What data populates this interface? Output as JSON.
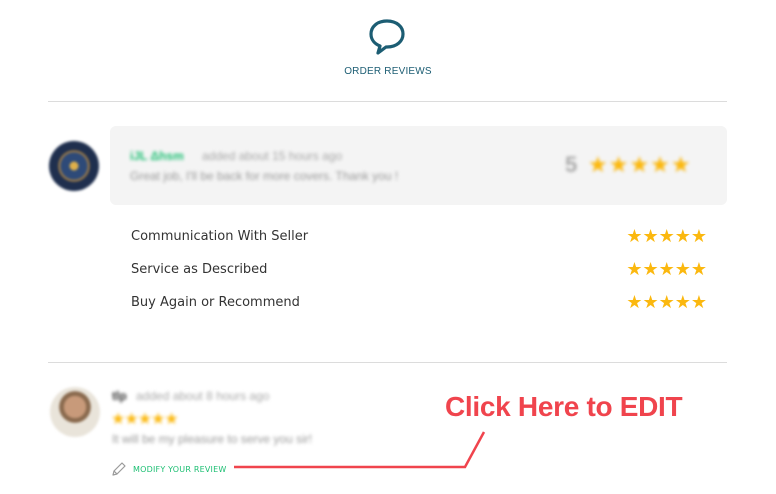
{
  "header": {
    "title": "ORDER REVIEWS",
    "icon": "speech-bubble-icon",
    "accent": "#1c5d73"
  },
  "buyer_review": {
    "name": "iJL Δhsm",
    "meta": "added about 15 hours ago",
    "text": "Great job, I'll be back for more covers. Thank you !",
    "score": "5",
    "stars": "★★★★★"
  },
  "criteria": [
    {
      "label": "Communication With Seller",
      "stars": "★★★★★",
      "rating": 5
    },
    {
      "label": "Service as Described",
      "stars": "★★★★★",
      "rating": 5
    },
    {
      "label": "Buy Again or Recommend",
      "stars": "★★★★★",
      "rating": 5
    }
  ],
  "seller_response": {
    "name": "tlp",
    "meta": "added about 8 hours ago",
    "stars": "★★★★★",
    "text": "It will be my pleasure to serve you sir!",
    "modify_label": "MODIFY YOUR REVIEW"
  },
  "annotation": {
    "text": "Click Here to EDIT",
    "color": "#f0444d"
  },
  "colors": {
    "star": "#fbb80f",
    "link_green": "#1dbf73"
  }
}
